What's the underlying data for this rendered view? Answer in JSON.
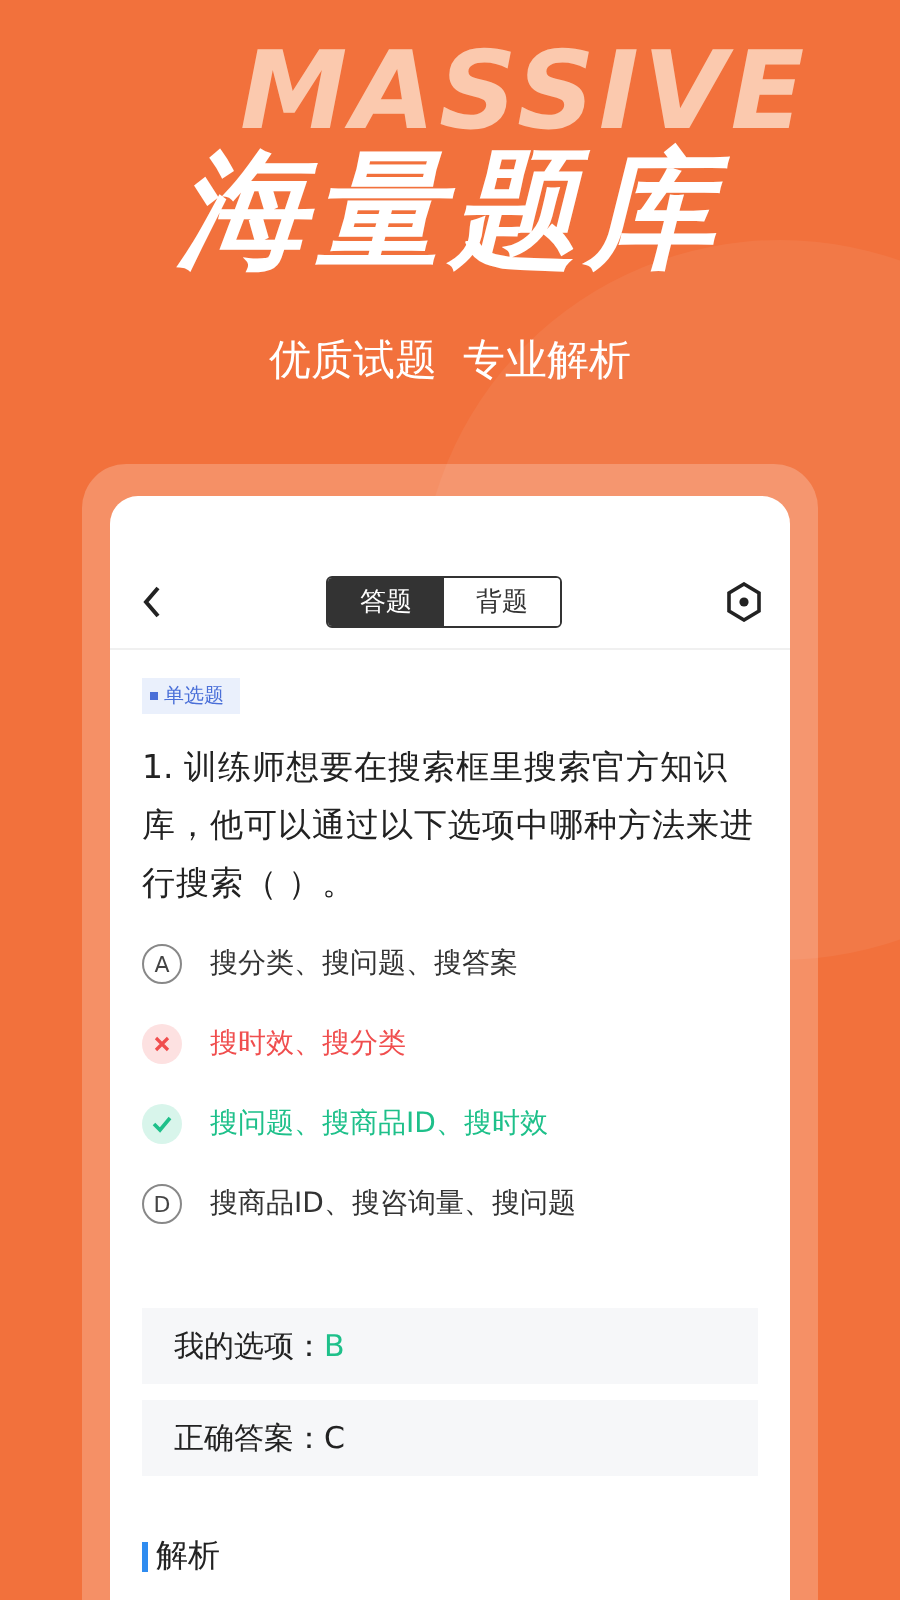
{
  "hero": {
    "backdrop_word": "MASSIVE",
    "title": "海量题库",
    "subtitle": "优质试题  专业解析"
  },
  "toolbar": {
    "tabs": [
      {
        "label": "答题",
        "selected": true
      },
      {
        "label": "背题",
        "selected": false
      }
    ]
  },
  "question": {
    "type_tag": "单选题",
    "text": "1.  训练师想要在搜索框里搜索官方知识库，他可以通过以下选项中哪种方法来进行搜索（ ）。",
    "options": [
      {
        "kind": "plain",
        "letter": "A",
        "text": "搜分类、搜问题、搜答案"
      },
      {
        "kind": "wrong",
        "text": "搜时效、搜分类"
      },
      {
        "kind": "correct",
        "text": "搜问题、搜商品ID、搜时效"
      },
      {
        "kind": "plain",
        "letter": "D",
        "text": "搜商品ID、搜咨询量、搜问题"
      }
    ]
  },
  "answers": [
    {
      "label": "我的选项：",
      "value": "B",
      "kind": "mine"
    },
    {
      "label": "正确答案：",
      "value": "C",
      "kind": "correct"
    }
  ],
  "analysis": {
    "heading": "解析"
  }
}
